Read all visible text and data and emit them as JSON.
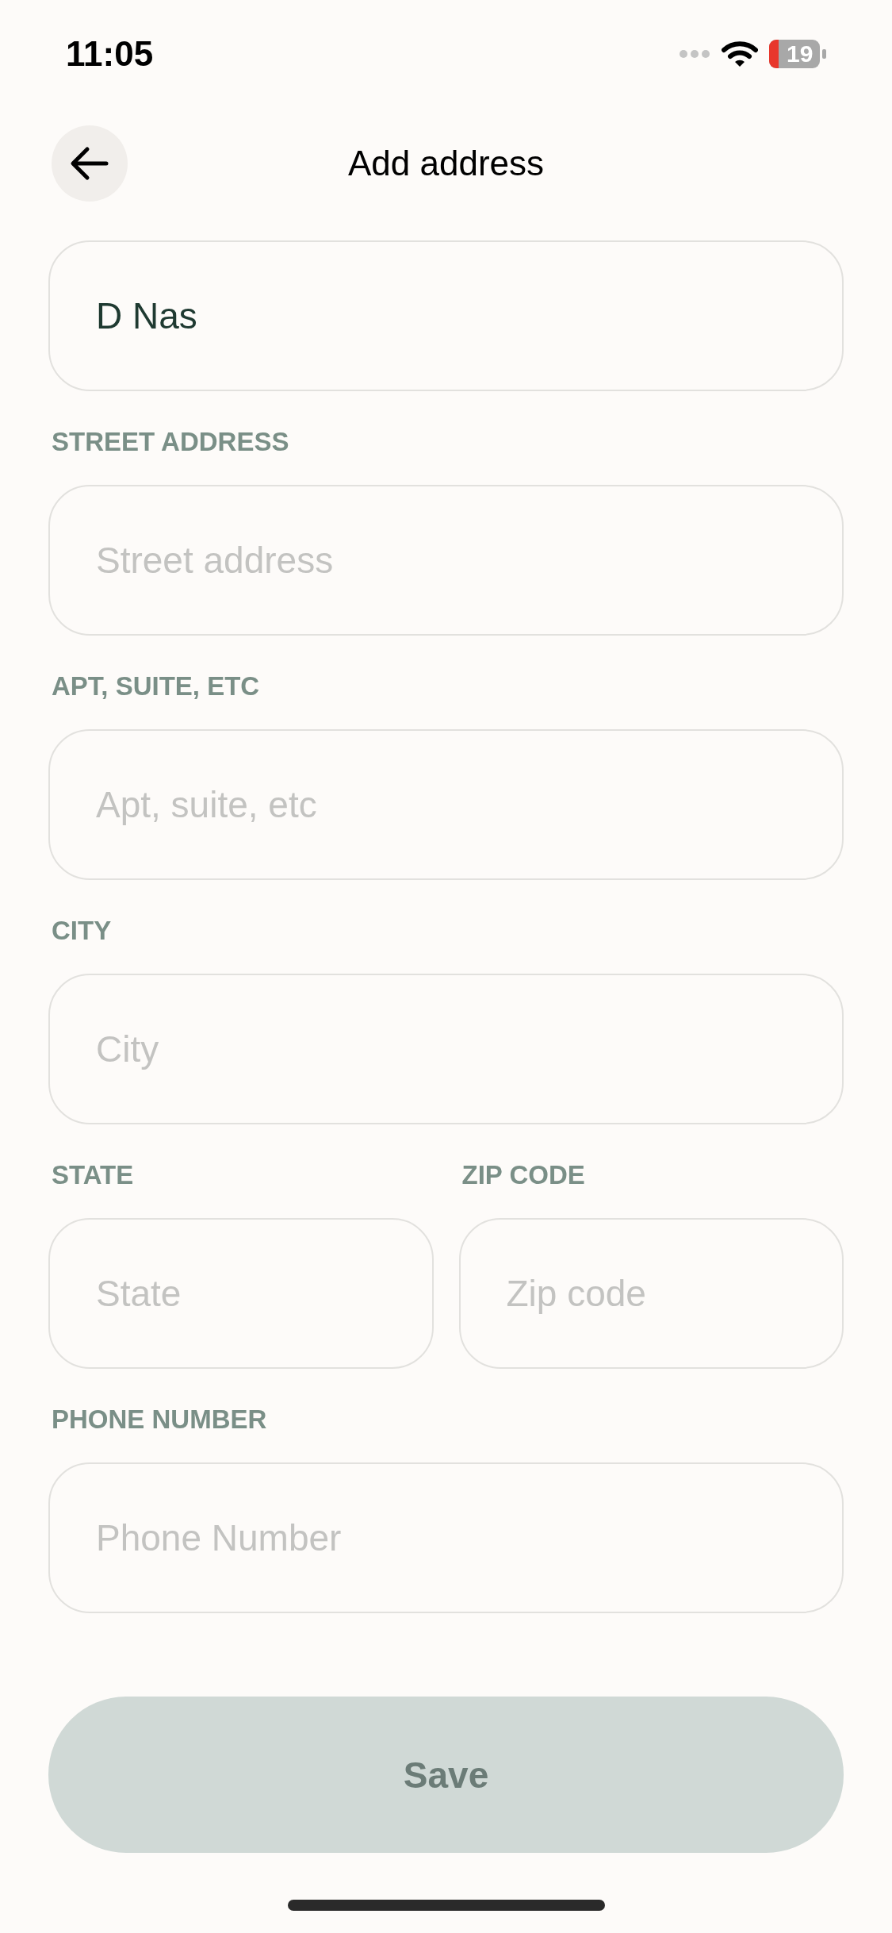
{
  "status_bar": {
    "time": "11:05",
    "battery": "19"
  },
  "header": {
    "title": "Add address"
  },
  "rows": [
    [
      {
        "value": "D Nas"
      }
    ],
    [
      {
        "label": "STREET ADDRESS",
        "placeholder": "Street address"
      }
    ],
    [
      {
        "label": "APT, SUITE, ETC",
        "placeholder": "Apt, suite, etc"
      }
    ],
    [
      {
        "label": "CITY",
        "placeholder": "City"
      }
    ],
    [
      {
        "label": "STATE",
        "placeholder": "State"
      },
      {
        "label": "ZIP CODE",
        "placeholder": "Zip code"
      }
    ],
    [
      {
        "label": "PHONE NUMBER",
        "placeholder": "Phone Number"
      }
    ]
  ],
  "save_button": {
    "label": "Save",
    "disabled": true
  }
}
